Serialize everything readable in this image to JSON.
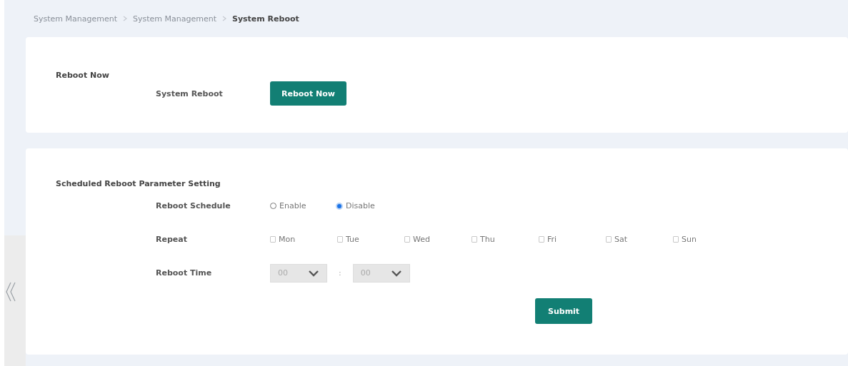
{
  "breadcrumb": [
    {
      "label": "System Management",
      "current": false
    },
    {
      "label": "System Management",
      "current": false
    },
    {
      "label": "System Reboot",
      "current": true
    }
  ],
  "reboot_now": {
    "title": "Reboot Now",
    "label": "System Reboot",
    "button": "Reboot Now"
  },
  "scheduled": {
    "title": "Scheduled Reboot Parameter Setting",
    "schedule": {
      "label": "Reboot Schedule",
      "options": [
        {
          "label": "Enable",
          "selected": false
        },
        {
          "label": "Disable",
          "selected": true
        }
      ]
    },
    "repeat": {
      "label": "Repeat",
      "days": [
        {
          "label": "Mon",
          "checked": false
        },
        {
          "label": "Tue",
          "checked": false
        },
        {
          "label": "Wed",
          "checked": false
        },
        {
          "label": "Thu",
          "checked": false
        },
        {
          "label": "Fri",
          "checked": false
        },
        {
          "label": "Sat",
          "checked": false
        },
        {
          "label": "Sun",
          "checked": false
        }
      ]
    },
    "time": {
      "label": "Reboot Time",
      "hour": "00",
      "separator": ":",
      "minute": "00",
      "disabled": true
    },
    "submit": "Submit"
  }
}
